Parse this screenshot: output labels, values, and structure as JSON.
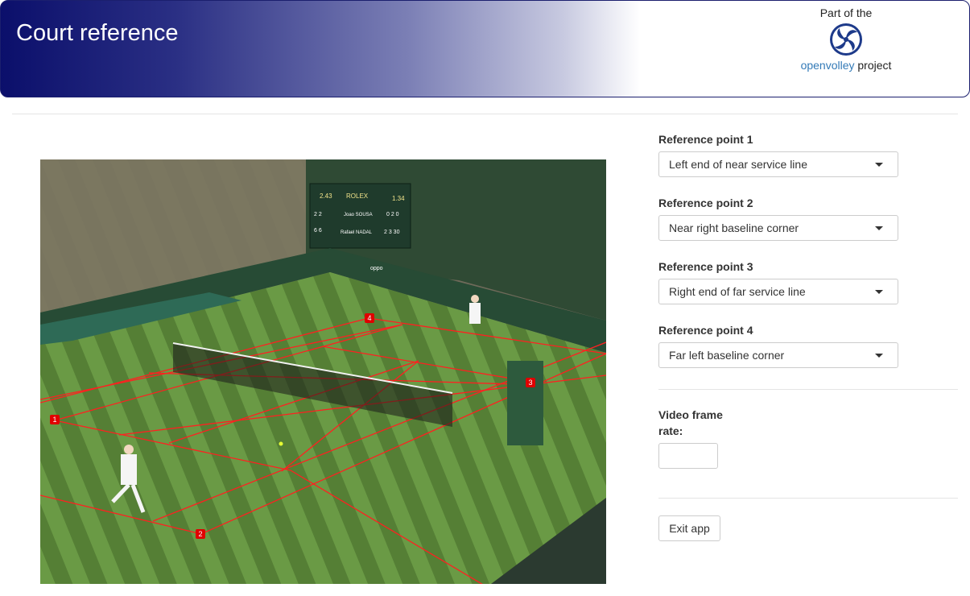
{
  "header": {
    "title": "Court reference",
    "brand_prefix": "Part of the",
    "brand_link": "openvolley",
    "brand_suffix": "project"
  },
  "image": {
    "scoreboard": {
      "top_left": "2.43",
      "top_right": "1.34",
      "brand": "ROLEX",
      "player1": "Joao SOUSA",
      "player2": "Rafael NADAL",
      "p1_games": "2 2",
      "p2_games": "6 6",
      "p1_current": "0 2 0",
      "p2_current": "2 3 30"
    },
    "sponsor": "oppo",
    "markers": [
      "1",
      "2",
      "3",
      "4"
    ]
  },
  "refs": [
    {
      "label": "Reference point 1",
      "value": "Left end of near service line"
    },
    {
      "label": "Reference point 2",
      "value": "Near right baseline corner"
    },
    {
      "label": "Reference point 3",
      "value": "Right end of far service line"
    },
    {
      "label": "Reference point 4",
      "value": "Far left baseline corner"
    }
  ],
  "fps": {
    "label": "Video frame rate:",
    "value": ""
  },
  "exit": {
    "label": "Exit app"
  },
  "colors": {
    "header_dark": "#0b0f6b",
    "court_line": "#ff1a1a",
    "grass": "#5d8a3a",
    "link": "#337ab7"
  }
}
